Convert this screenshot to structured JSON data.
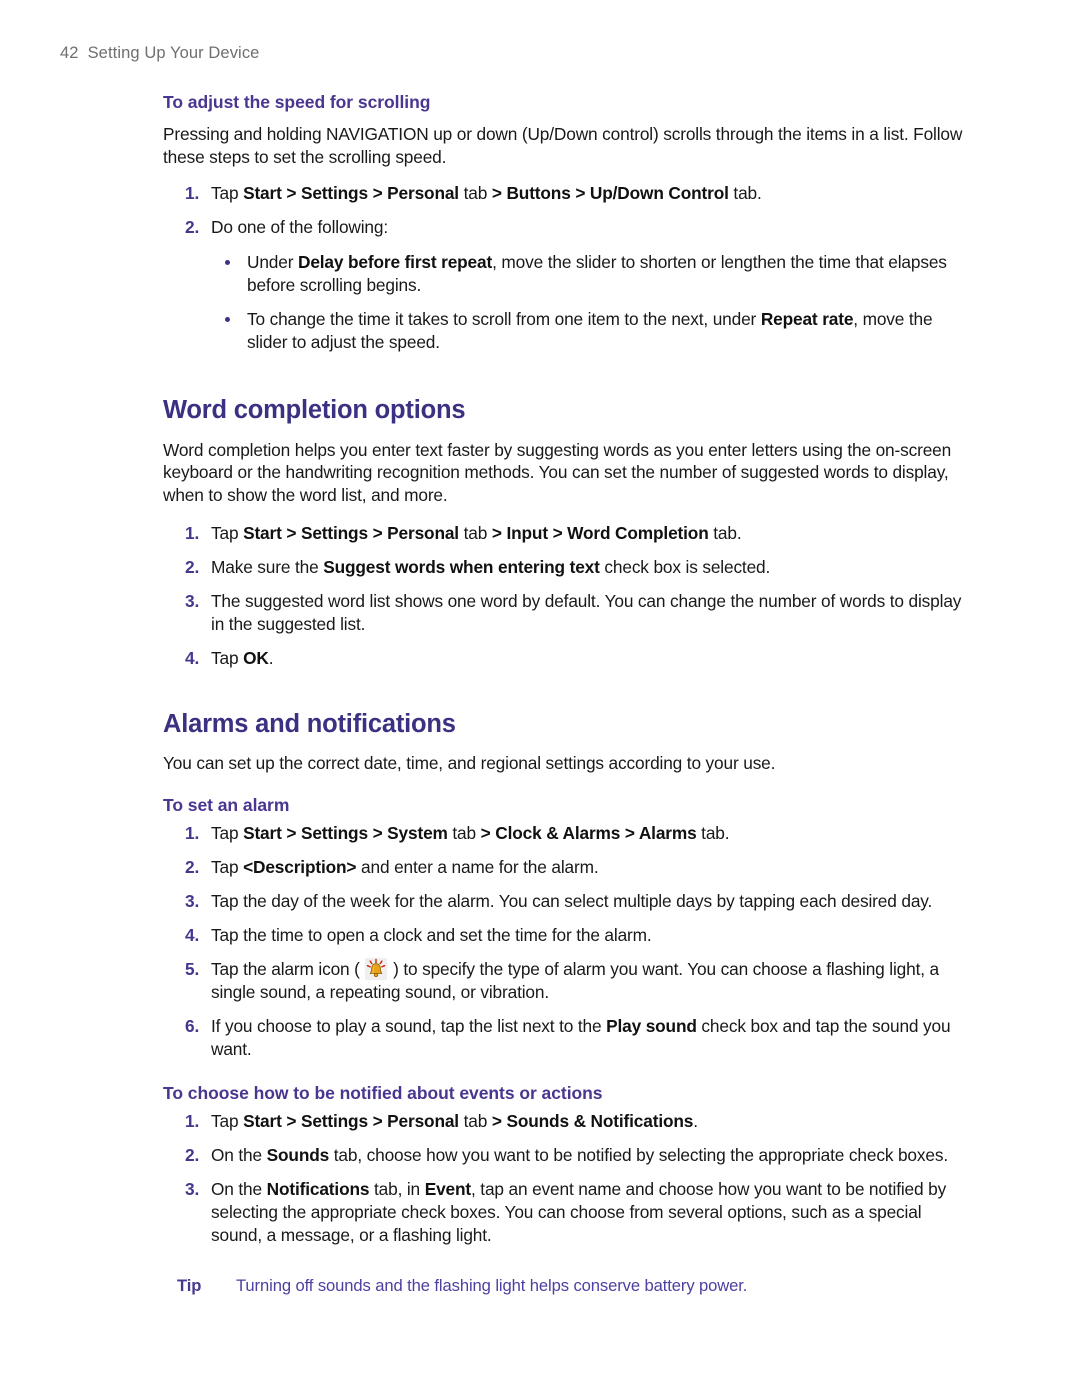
{
  "header": {
    "folio": "42",
    "title": "Setting Up Your Device"
  },
  "sections": [
    {
      "kind": "subheading",
      "heading": "To adjust the speed for scrolling",
      "intro": "Pressing and holding NAVIGATION up or down (Up/Down control) scrolls through the items in a list. Follow these steps to set the scrolling speed.",
      "steps": [
        {
          "num": "1.",
          "text_html": "Tap <b>Start &gt; Settings &gt; Personal</b> tab <b>&gt; Buttons &gt; Up/Down Control</b> tab."
        },
        {
          "num": "2.",
          "text_html": "Do one of the following:"
        }
      ],
      "bullets": [
        "Under <b>Delay before first repeat</b>, move the slider to shorten or lengthen the time that elapses before scrolling begins.",
        "To change the time it takes to scroll from one item to the next, under <b>Repeat rate</b>, move the slider to adjust the speed."
      ]
    },
    {
      "kind": "section",
      "heading": "Word completion options",
      "intro": "Word completion helps you enter text faster by suggesting words as you enter letters using the on-screen keyboard or the handwriting recognition methods. You can set the number of suggested words to display, when to show the word list, and more.",
      "steps": [
        {
          "num": "1.",
          "text_html": "Tap <b>Start &gt; Settings &gt; Personal</b> tab <b>&gt; Input &gt; Word Completion</b> tab."
        },
        {
          "num": "2.",
          "text_html": "Make sure the <b>Suggest words when entering text</b> check box is selected."
        },
        {
          "num": "3.",
          "text_html": "The suggested word list shows one word by default. You can change the number of words to display in the suggested list."
        },
        {
          "num": "4.",
          "text_html": "Tap <b>OK</b>."
        }
      ]
    },
    {
      "kind": "section",
      "heading": "Alarms and notifications",
      "intro": "You can set up the correct date, time, and regional settings according to your use.",
      "subsections": [
        {
          "heading": "To set an alarm",
          "steps": [
            {
              "num": "1.",
              "text_html": "Tap <b>Start &gt; Settings &gt; System</b> tab <b>&gt; Clock &amp; Alarms &gt; Alarms</b> tab."
            },
            {
              "num": "2.",
              "text_html": "Tap <b>&lt;Description&gt;</b> and enter a name for the alarm."
            },
            {
              "num": "3.",
              "text_html": "Tap the day of the week for the alarm. You can select multiple days by tapping each desired day."
            },
            {
              "num": "4.",
              "text_html": "Tap the time to open a clock and set the time for the alarm."
            },
            {
              "num": "5.",
              "text_html": "Tap the alarm icon ( @ALARM_ICON@ ) to specify the type of alarm you want. You can choose a flashing light, a single sound, a repeating sound, or vibration."
            },
            {
              "num": "6.",
              "text_html": "If you choose to play a sound, tap the list next to the <b>Play sound</b> check box and tap the sound you want."
            }
          ]
        },
        {
          "heading": "To choose how to be notified about events or actions",
          "steps": [
            {
              "num": "1.",
              "text_html": "Tap <b>Start &gt; Settings &gt; Personal</b> tab <b>&gt; Sounds &amp; Notifications</b>."
            },
            {
              "num": "2.",
              "text_html": "On the <b>Sounds</b> tab, choose how you want to be notified by selecting the appropriate check boxes."
            },
            {
              "num": "3.",
              "text_html": "On the <b>Notifications</b> tab, in <b>Event</b>, tap an event name and choose how you want to be notified by selecting the appropriate check boxes. You can choose from several options, such as a special sound, a message, or a flashing light."
            }
          ]
        }
      ]
    }
  ],
  "tip": {
    "label": "Tip",
    "text": "Turning off sounds and the flashing light helps conserve battery power."
  },
  "icons": {
    "alarm_bell": "alarm-bell-icon"
  },
  "colors": {
    "section_heading": "#3b3182",
    "sub_heading": "#4a3590",
    "list_number": "#46368e",
    "bullet": "#3c3480",
    "tip": "#4c40a0",
    "header_gray": "#6f6f72",
    "body": "#191919",
    "bell_gold": "#e8a317",
    "bell_ray": "#cc2200"
  }
}
